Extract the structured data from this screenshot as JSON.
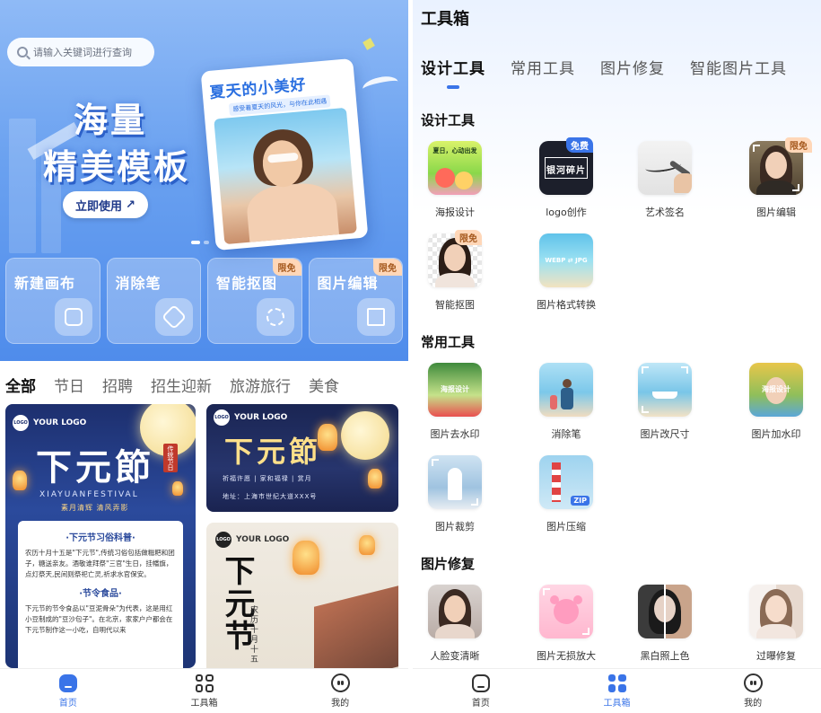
{
  "left": {
    "search": {
      "placeholder": "请输入关键词进行查询"
    },
    "banner": {
      "title_line1": "海量",
      "title_line2": "精美模板",
      "cta": "立即使用",
      "poster_title": "夏天的小美好",
      "poster_subtitle": "感受着夏天的风光，与你在此相遇"
    },
    "quick_actions": [
      {
        "label": "新建画布",
        "icon": "new-canvas-icon",
        "tag": ""
      },
      {
        "label": "消除笔",
        "icon": "eraser-icon",
        "tag": ""
      },
      {
        "label": "智能抠图",
        "icon": "cutout-icon",
        "tag": "限免"
      },
      {
        "label": "图片编辑",
        "icon": "crop-icon",
        "tag": "限免"
      }
    ],
    "categories": [
      "全部",
      "节日",
      "招聘",
      "招生迎新",
      "旅游旅行",
      "美食"
    ],
    "active_category": "全部",
    "templates": {
      "t1": {
        "logo": "YOUR LOGO",
        "title": "下元節",
        "seal": "传统节日",
        "en": "XIAYUANFESTIVAL",
        "motto": "素月清辉 清风弄影",
        "section1": "·下元节习俗科普·",
        "para1": "农历十月十五是\"下元节\",传统习俗包括做糍粑和团子，糖送亲友。酒敬谁拜祭\"三官\"生日，挂幡旗，点灯祭天,民间则祭祀亡灵,祈求水官保安。",
        "section2": "·节令食品·",
        "para2": "下元节的节令食品以\"豆泥骨朵\"为代表，这是用红小豆制成的\"豆沙包子\"。在北京，家家户户都会在下元节制作这一小吃，自明代以来"
      },
      "t2": {
        "logo": "YOUR LOGO",
        "title": "下元節",
        "sub": "祈福许愿 | 家和福禄 | 赏月",
        "addr": "地址：上海市世纪大道XXX号"
      },
      "t3": {
        "logo": "YOUR LOGO",
        "title": "下元节",
        "date": "农历十月十五"
      }
    },
    "tabbar": [
      {
        "label": "首页",
        "icon": "home-icon",
        "active": true
      },
      {
        "label": "工具箱",
        "icon": "toolbox-icon",
        "active": false
      },
      {
        "label": "我的",
        "icon": "profile-icon",
        "active": false
      }
    ]
  },
  "right": {
    "title": "工具箱",
    "tabs": [
      "设计工具",
      "常用工具",
      "图片修复",
      "智能图片工具"
    ],
    "active_tab": "设计工具",
    "sections": [
      {
        "title": "设计工具",
        "tools": [
          {
            "name": "海报设计",
            "tag": "",
            "icon": "poster-design-icon",
            "thumb_text": "夏日，心动出发"
          },
          {
            "name": "logo创作",
            "tag": "免费",
            "icon": "logo-create-icon",
            "thumb_text": "银河碎片"
          },
          {
            "name": "艺术签名",
            "tag": "",
            "icon": "signature-icon",
            "thumb_text": ""
          },
          {
            "name": "图片编辑",
            "tag": "限免",
            "icon": "image-edit-icon",
            "thumb_text": ""
          },
          {
            "name": "智能抠图",
            "tag": "限免",
            "icon": "smart-cutout-icon",
            "thumb_text": ""
          },
          {
            "name": "图片格式转换",
            "tag": "",
            "icon": "format-convert-icon",
            "thumb_text": "WEBP ⇄ JPG"
          }
        ]
      },
      {
        "title": "常用工具",
        "tools": [
          {
            "name": "图片去水印",
            "tag": "",
            "icon": "remove-watermark-icon",
            "thumb_text": "海报设计"
          },
          {
            "name": "消除笔",
            "tag": "",
            "icon": "eraser-pen-icon",
            "thumb_text": ""
          },
          {
            "name": "图片改尺寸",
            "tag": "",
            "icon": "resize-icon",
            "thumb_text": ""
          },
          {
            "name": "图片加水印",
            "tag": "",
            "icon": "add-watermark-icon",
            "thumb_text": "海报设计"
          },
          {
            "name": "图片裁剪",
            "tag": "",
            "icon": "crop-image-icon",
            "thumb_text": ""
          },
          {
            "name": "图片压缩",
            "tag": "",
            "icon": "compress-icon",
            "thumb_text": "ZIP"
          }
        ]
      },
      {
        "title": "图片修复",
        "tools": [
          {
            "name": "人脸变清晰",
            "tag": "",
            "icon": "face-enhance-icon",
            "thumb_text": ""
          },
          {
            "name": "图片无损放大",
            "tag": "",
            "icon": "upscale-icon",
            "thumb_text": ""
          },
          {
            "name": "黑白照上色",
            "tag": "",
            "icon": "colorize-icon",
            "thumb_text": ""
          },
          {
            "name": "过曝修复",
            "tag": "",
            "icon": "exposure-fix-icon",
            "thumb_text": ""
          }
        ]
      }
    ],
    "tabbar": [
      {
        "label": "首页",
        "icon": "home-icon",
        "active": false
      },
      {
        "label": "工具箱",
        "icon": "toolbox-icon",
        "active": true
      },
      {
        "label": "我的",
        "icon": "profile-icon",
        "active": false
      }
    ]
  },
  "colors": {
    "accent": "#3a74e8",
    "free_tag_bg": "#ffd7b8",
    "free_tag_text": "#a65a1f",
    "hero_blue": "#6aa1f0"
  }
}
